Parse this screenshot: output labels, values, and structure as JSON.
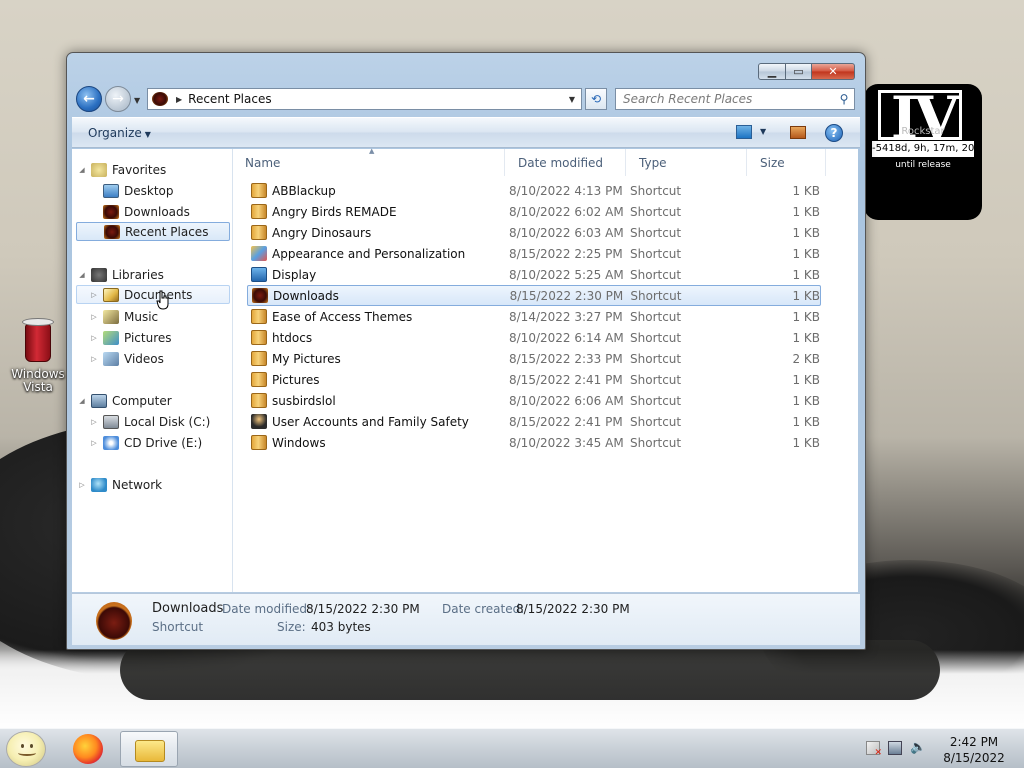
{
  "desktop": {
    "icons": [
      {
        "label": "Windows Vista"
      }
    ],
    "gadget": {
      "logo": "IV",
      "sub": "Rockstar",
      "countdown": "-5418d, 9h, 17m, 20",
      "caption": "until release"
    }
  },
  "window": {
    "controls": {
      "minimize": "▁",
      "maximize": "▭",
      "close": "✕"
    },
    "address": {
      "location": "Recent Places"
    },
    "search": {
      "placeholder": "Search Recent Places"
    },
    "toolbar": {
      "organize_label": "Organize"
    },
    "nav_pane": {
      "favorites": {
        "label": "Favorites",
        "items": [
          {
            "label": "Desktop"
          },
          {
            "label": "Downloads"
          },
          {
            "label": "Recent Places",
            "selected": true
          }
        ]
      },
      "libraries": {
        "label": "Libraries",
        "items": [
          {
            "label": "Documents"
          },
          {
            "label": "Music"
          },
          {
            "label": "Pictures"
          },
          {
            "label": "Videos"
          }
        ]
      },
      "computer": {
        "label": "Computer",
        "items": [
          {
            "label": "Local Disk (C:)"
          },
          {
            "label": "CD Drive (E:)"
          }
        ]
      },
      "network": {
        "label": "Network"
      }
    },
    "columns": {
      "name": "Name",
      "date_modified": "Date modified",
      "type": "Type",
      "size": "Size"
    },
    "files": [
      {
        "name": "ABBlackup",
        "date": "8/10/2022 4:13 PM",
        "type": "Shortcut",
        "size": "1 KB"
      },
      {
        "name": "Angry Birds REMADE",
        "date": "8/10/2022 6:02 AM",
        "type": "Shortcut",
        "size": "1 KB"
      },
      {
        "name": "Angry Dinosaurs",
        "date": "8/10/2022 6:03 AM",
        "type": "Shortcut",
        "size": "1 KB"
      },
      {
        "name": "Appearance and Personalization",
        "date": "8/15/2022 2:25 PM",
        "type": "Shortcut",
        "size": "1 KB"
      },
      {
        "name": "Display",
        "date": "8/10/2022 5:25 AM",
        "type": "Shortcut",
        "size": "1 KB"
      },
      {
        "name": "Downloads",
        "date": "8/15/2022 2:30 PM",
        "type": "Shortcut",
        "size": "1 KB",
        "selected": true
      },
      {
        "name": "Ease of Access Themes",
        "date": "8/14/2022 3:27 PM",
        "type": "Shortcut",
        "size": "1 KB"
      },
      {
        "name": "htdocs",
        "date": "8/10/2022 6:14 AM",
        "type": "Shortcut",
        "size": "1 KB"
      },
      {
        "name": "My Pictures",
        "date": "8/15/2022 2:33 PM",
        "type": "Shortcut",
        "size": "2 KB"
      },
      {
        "name": "Pictures",
        "date": "8/15/2022 2:41 PM",
        "type": "Shortcut",
        "size": "1 KB"
      },
      {
        "name": "susbirdslol",
        "date": "8/10/2022 6:06 AM",
        "type": "Shortcut",
        "size": "1 KB"
      },
      {
        "name": "User Accounts and Family Safety",
        "date": "8/15/2022 2:41 PM",
        "type": "Shortcut",
        "size": "1 KB"
      },
      {
        "name": "Windows",
        "date": "8/10/2022 3:45 AM",
        "type": "Shortcut",
        "size": "1 KB"
      }
    ],
    "details": {
      "name": "Downloads",
      "type": "Shortcut",
      "date_modified_label": "Date modified:",
      "date_modified": "8/15/2022 2:30 PM",
      "date_created_label": "Date created:",
      "date_created": "8/15/2022 2:30 PM",
      "size_label": "Size:",
      "size": "403 bytes"
    }
  },
  "taskbar": {
    "clock": {
      "time": "2:42 PM",
      "date": "8/15/2022"
    }
  }
}
